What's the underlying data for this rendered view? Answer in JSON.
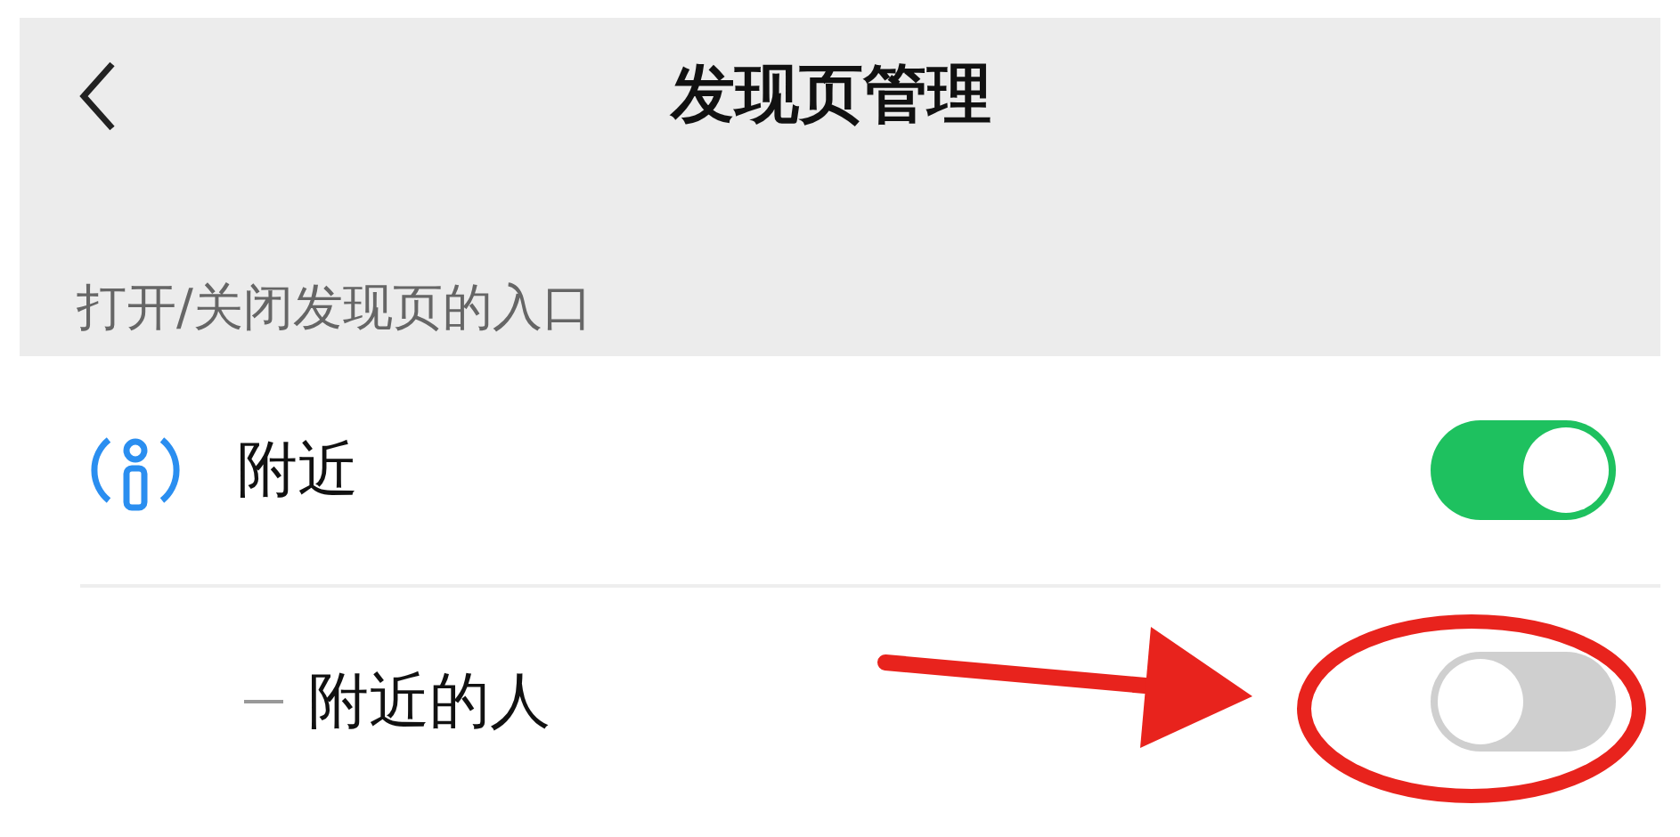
{
  "header": {
    "title": "发现页管理"
  },
  "section": {
    "label": "打开/关闭发现页的入口"
  },
  "rows": [
    {
      "kind": "main",
      "label": "附近",
      "on": true
    },
    {
      "kind": "sub",
      "label": "附近的人",
      "on": false
    }
  ],
  "annotation": {
    "kind": "circle-arrow"
  }
}
